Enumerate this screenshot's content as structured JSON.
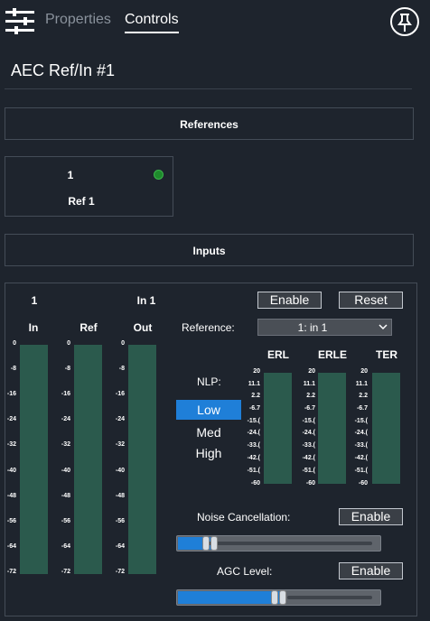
{
  "tabs": {
    "properties": "Properties",
    "controls": "Controls"
  },
  "title": "AEC Ref/In #1",
  "references": {
    "header": "References",
    "ref_number": "1",
    "ref_name": "Ref 1",
    "status_color": "#1e8a2c"
  },
  "inputs": {
    "header": "Inputs"
  },
  "meters": {
    "channel_number": "1",
    "channel_name": "In 1",
    "labels": [
      "In",
      "Ref",
      "Out"
    ],
    "scale": [
      "0",
      "-8",
      "-16",
      "-24",
      "-32",
      "-40",
      "-48",
      "-56",
      "-64",
      "-72"
    ]
  },
  "buttons": {
    "enable": "Enable",
    "reset": "Reset"
  },
  "reference": {
    "label": "Reference:",
    "value": "1: in 1"
  },
  "nlp": {
    "label": "NLP:",
    "options": [
      "Low",
      "Med",
      "High"
    ],
    "selected": "Low"
  },
  "erl_meters": {
    "labels": [
      "ERL",
      "ERLE",
      "TER"
    ],
    "scale": [
      "20",
      "11.1",
      "2.2",
      "-6.7",
      "-15.(",
      "-24.(",
      "-33.(",
      "-42.(",
      "-51.(",
      "-60"
    ]
  },
  "noise_cancellation": {
    "label": "Noise Cancellation:",
    "button": "Enable",
    "level": 0.18
  },
  "agc": {
    "label": "AGC Level:",
    "button": "Enable",
    "level": 0.52
  },
  "colors": {
    "accent": "#1f7fd8",
    "meter": "#2b5a4d",
    "background": "#1e242d"
  }
}
